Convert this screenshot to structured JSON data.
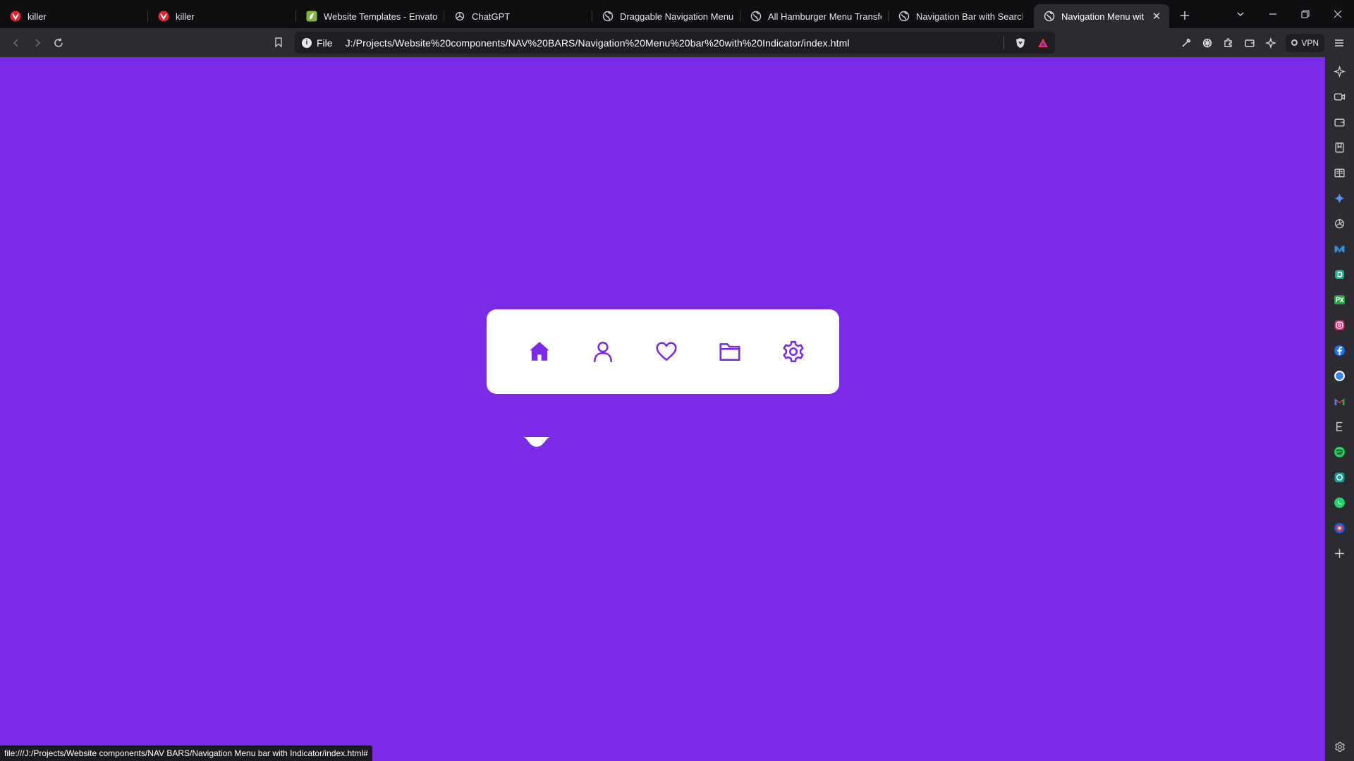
{
  "tabs": [
    {
      "label": "killer",
      "icon": "vivaldi-icon"
    },
    {
      "label": "killer",
      "icon": "vivaldi-icon"
    },
    {
      "label": "Website Templates - Envato",
      "icon": "envato-icon"
    },
    {
      "label": "ChatGPT",
      "icon": "chatgpt-icon"
    },
    {
      "label": "Draggable Navigation Menu",
      "icon": "globe-icon"
    },
    {
      "label": "All Hamburger Menu Transfor",
      "icon": "globe-icon"
    },
    {
      "label": "Navigation Bar with Search Bo",
      "icon": "globe-icon"
    },
    {
      "label": "Navigation Menu with Inc",
      "icon": "globe-icon",
      "active": true
    }
  ],
  "address_bar": {
    "scheme_label": "File",
    "url": "J:/Projects/Website%20components/NAV%20BARS/Navigation%20Menu%20bar%20with%20Indicator/index.html"
  },
  "toolbar": {
    "vpn_label": "VPN"
  },
  "nav_menu": {
    "items": [
      {
        "icon": "home-icon",
        "active": true
      },
      {
        "icon": "user-icon",
        "active": false
      },
      {
        "icon": "heart-icon",
        "active": false
      },
      {
        "icon": "folder-icon",
        "active": false
      },
      {
        "icon": "gear-icon",
        "active": false
      }
    ]
  },
  "status_bar": {
    "text": "file:///J:/Projects/Website components/NAV BARS/Navigation Menu bar with Indicator/index.html#"
  },
  "colors": {
    "page_background": "#7b2ae8",
    "nav_background": "#ffffff",
    "nav_icon": "#7b2ae8",
    "browser_chrome": "#2b2b31",
    "tab_strip": "#0f0f12"
  }
}
